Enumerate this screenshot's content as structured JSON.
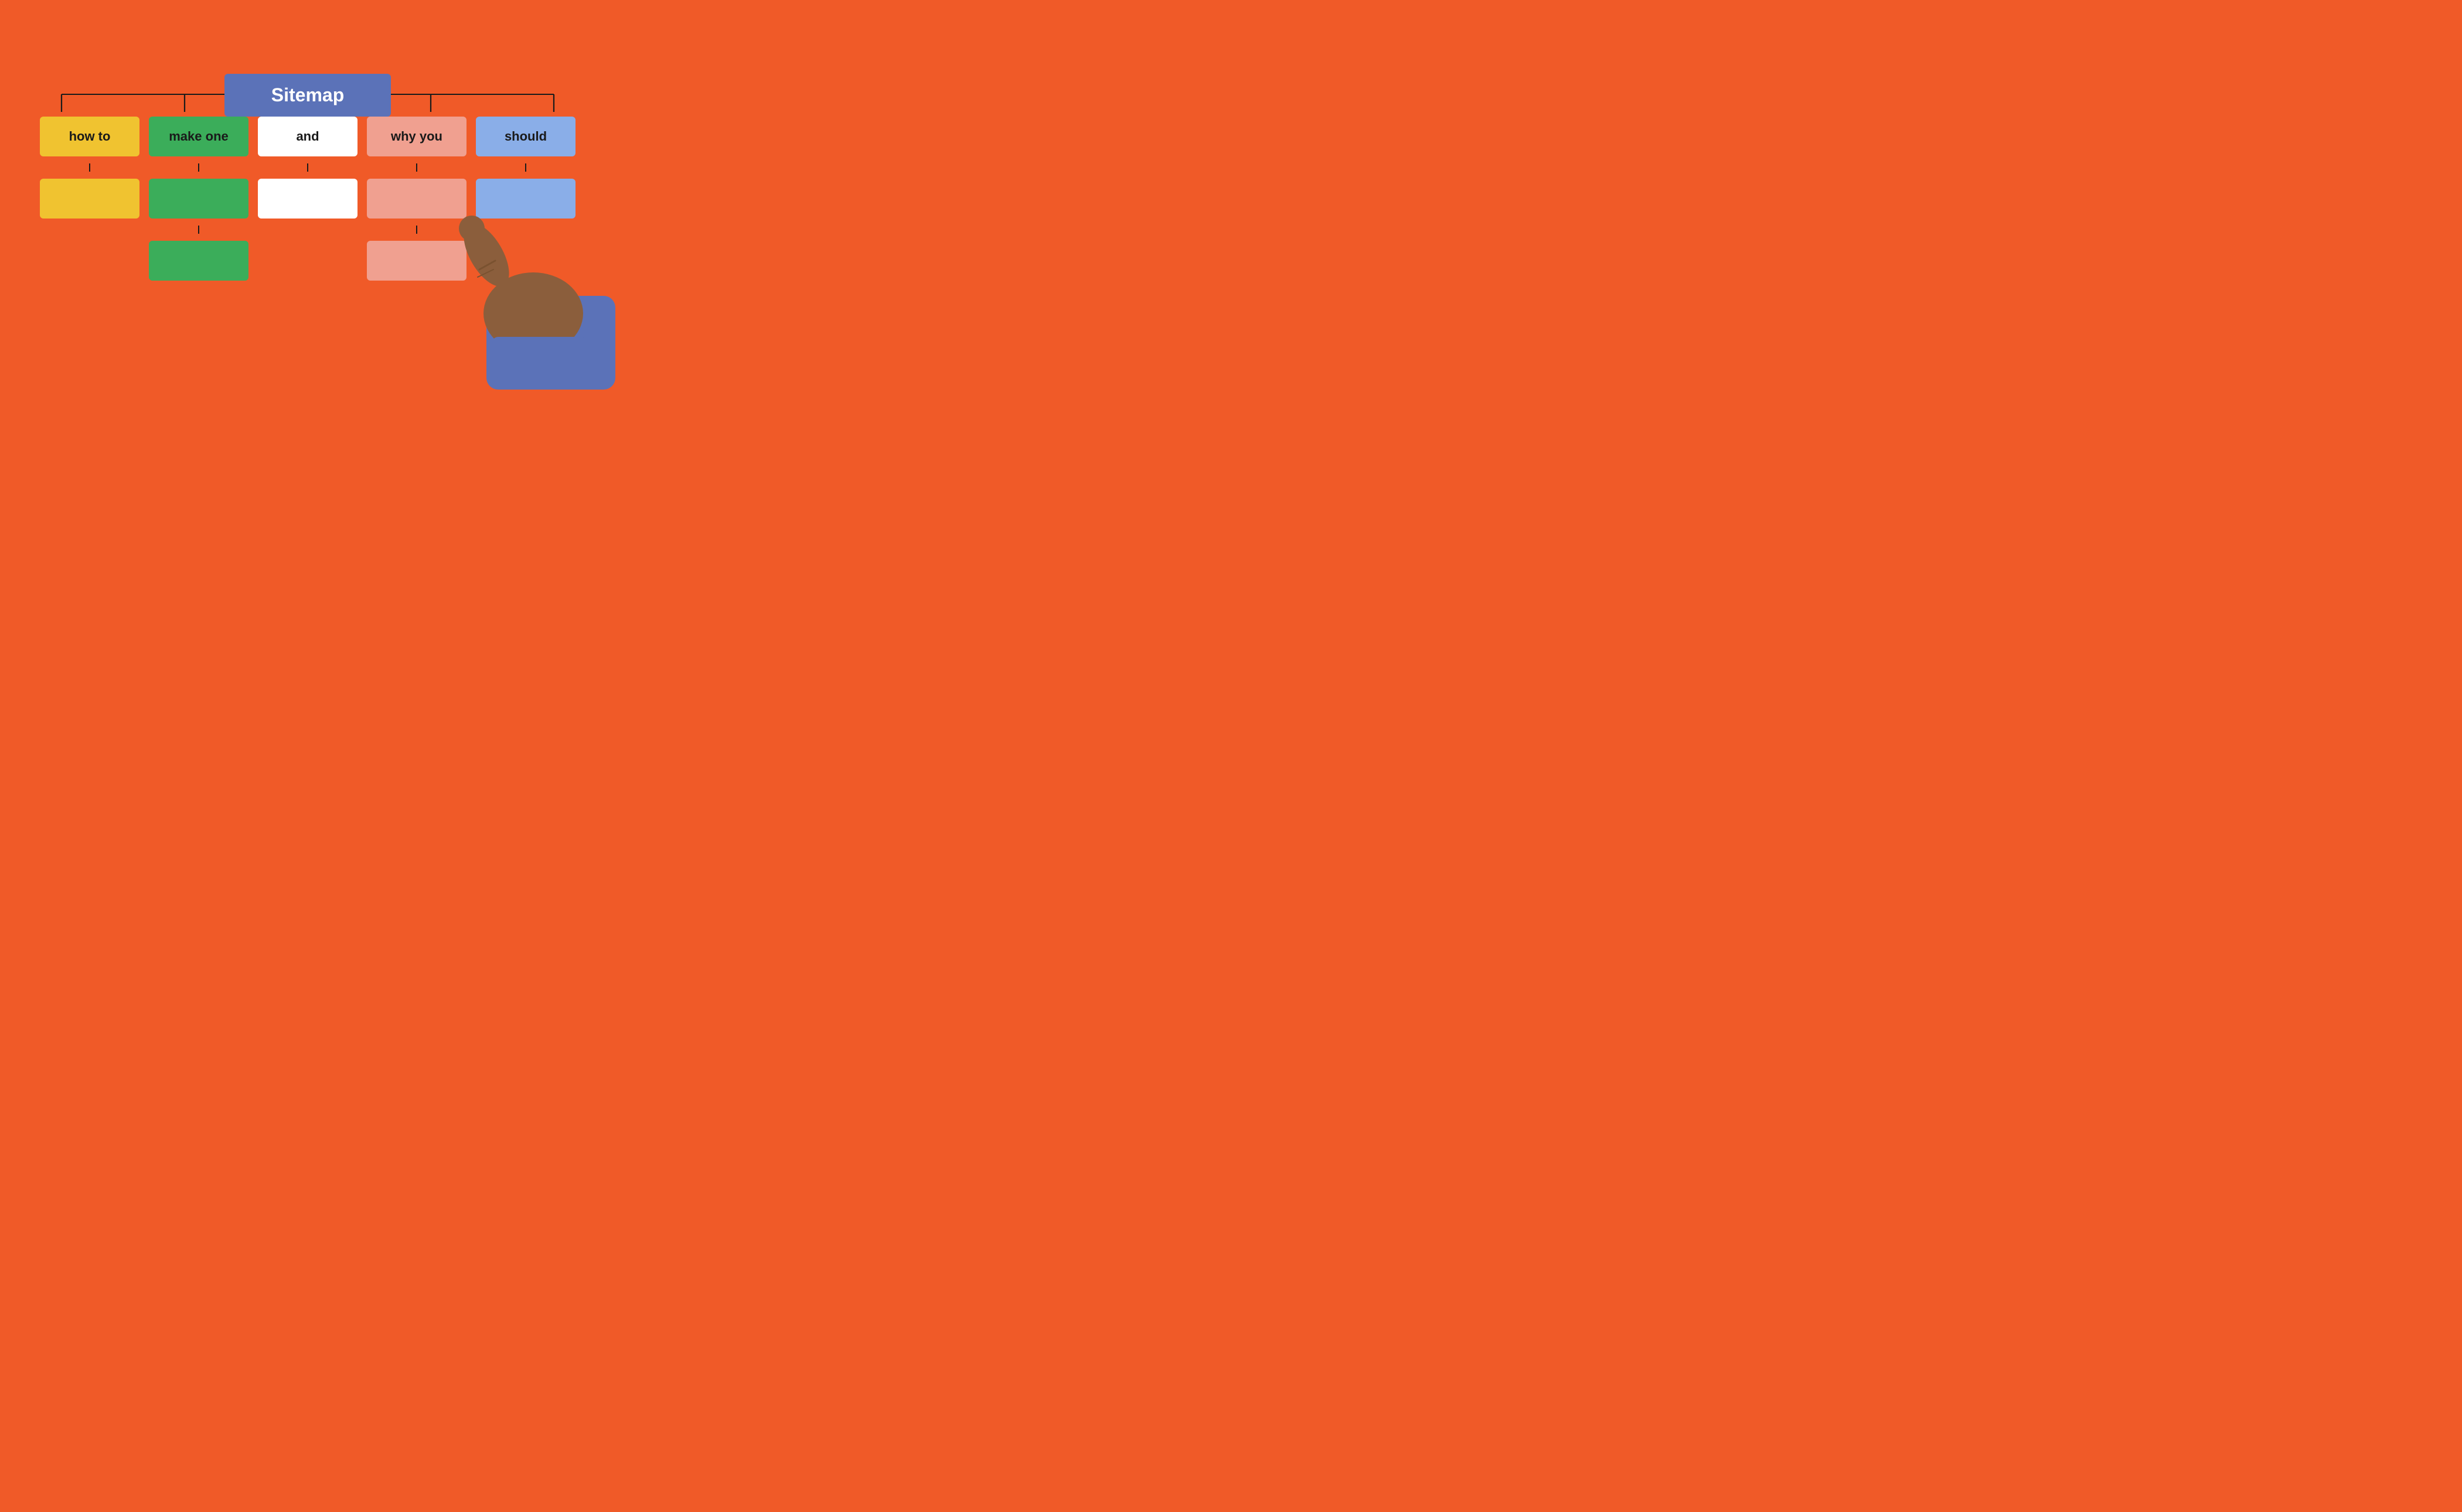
{
  "root": {
    "label": "Sitemap"
  },
  "children": [
    {
      "id": "how-to",
      "label": "how to",
      "color": "yellow",
      "sub_nodes": [
        {
          "color": "yellow-sub",
          "label": ""
        }
      ]
    },
    {
      "id": "make-one",
      "label": "make one",
      "color": "green",
      "sub_nodes": [
        {
          "color": "green-sub",
          "label": ""
        },
        {
          "color": "green-sub",
          "label": ""
        }
      ]
    },
    {
      "id": "and",
      "label": "and",
      "color": "white",
      "sub_nodes": [
        {
          "color": "white-sub",
          "label": ""
        }
      ]
    },
    {
      "id": "why-you",
      "label": "why you",
      "color": "pink",
      "sub_nodes": [
        {
          "color": "pink-sub",
          "label": ""
        },
        {
          "color": "pink-sub",
          "label": ""
        }
      ]
    },
    {
      "id": "should",
      "label": "should",
      "color": "blue-light",
      "sub_nodes": [
        {
          "color": "blue-sub",
          "label": ""
        }
      ]
    }
  ],
  "colors": {
    "background": "#F05A28",
    "root_bg": "#5B72B8",
    "line": "#1a1a1a"
  }
}
